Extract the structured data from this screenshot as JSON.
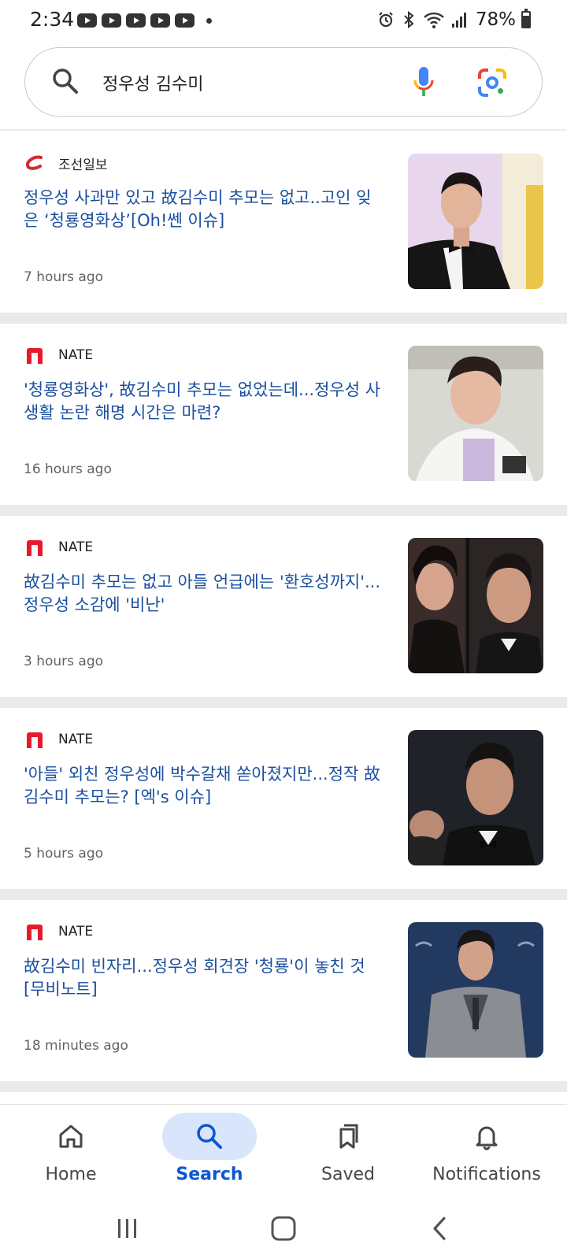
{
  "status_bar": {
    "time": "2:34",
    "battery": "78%",
    "icons": [
      "youtube-icon",
      "youtube-icon",
      "youtube-icon",
      "youtube-icon",
      "youtube-icon",
      "dot-icon",
      "alarm-icon",
      "bluetooth-icon",
      "wifi-icon",
      "signal-icon",
      "battery-icon"
    ]
  },
  "search": {
    "query": "정우성 김수미",
    "icons": [
      "search-icon",
      "mic-icon",
      "lens-icon"
    ]
  },
  "articles": [
    {
      "source": "조선일보",
      "headline": "정우성 사과만 있고 故김수미 추모는 없고..고인 잊은 ‘청룡영화상’[Oh!쎈 이슈]",
      "time": "7 hours ago",
      "logo": "chosun-logo-icon"
    },
    {
      "source": "NATE",
      "headline": "'청룡영화상', 故김수미 추모는 없었는데...정우성 사생활 논란 해명 시간은 마련?",
      "time": "16 hours ago",
      "logo": "nate-logo-icon"
    },
    {
      "source": "NATE",
      "headline": "故김수미 추모는 없고 아들 언급에는 '환호성까지'...정우성 소감에 '비난'",
      "time": "3 hours ago",
      "logo": "nate-logo-icon"
    },
    {
      "source": "NATE",
      "headline": "'아들' 외친 정우성에 박수갈채 쏟아졌지만...정작 故김수미 추모는? [엑's 이슈]",
      "time": "5 hours ago",
      "logo": "nate-logo-icon"
    },
    {
      "source": "NATE",
      "headline": "故김수미 빈자리...정우성 회견장 '청룡'이 놓친 것 [무비노트]",
      "time": "18 minutes ago",
      "logo": "nate-logo-icon"
    }
  ],
  "bottom_nav": {
    "home": "Home",
    "search": "Search",
    "saved": "Saved",
    "notifications": "Notifications",
    "active": "Search"
  },
  "colors": {
    "headline": "#1a4fa0",
    "accent": "#0b57d0",
    "active_pill": "#d9e5fb",
    "separator": "#e9eaee",
    "nate_red": "#e8192c",
    "chosun_red": "#d7282f"
  }
}
